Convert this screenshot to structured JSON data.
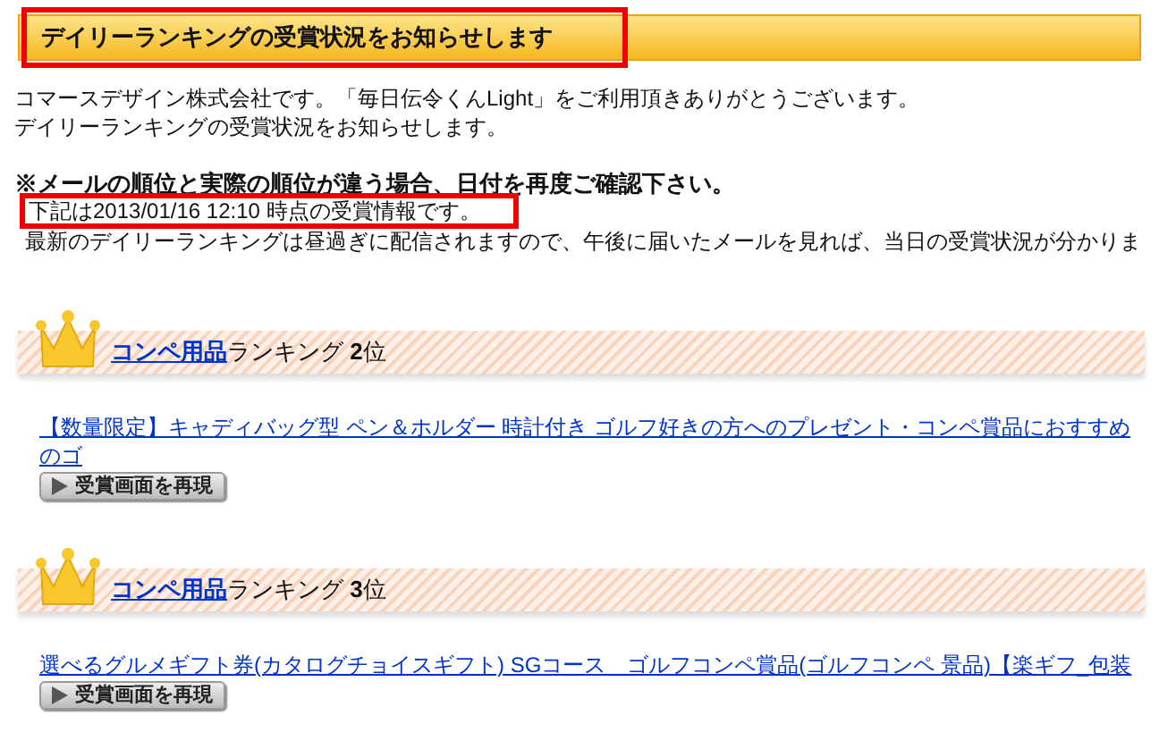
{
  "heading": "デイリーランキングの受賞状況をお知らせします",
  "intro": [
    "コマースデザイン株式会社です。「毎日伝令くんLight」をご利用頂きありがとうございます。",
    "デイリーランキングの受賞状況をお知らせします。"
  ],
  "notice": "※メールの順位と実際の順位が違う場合、日付を再度ご確認下さい。",
  "date_note": "下記は2013/01/16 12:10 時点の受賞情報です。",
  "note": "最新のデイリーランキングは昼過ぎに配信されますので、午後に届いたメールを見れば、当日の受賞状況が分かりま",
  "rankings": [
    {
      "category": "コンペ用品",
      "label": "ランキング **2**位",
      "item": "【数量限定】キャディバッグ型 ペン＆ホルダー 時計付き ゴルフ好きの方へのプレゼント・コンペ賞品におすすめのゴ",
      "button": "受賞画面を再現"
    },
    {
      "category": "コンペ用品",
      "label": "ランキング **3**位",
      "item": "選べるグルメギフト券(カタログチョイスギフト) SGコース　ゴルフコンペ賞品(ゴルフコンペ 景品)【楽ギフ_包装",
      "button": "受賞画面を再現"
    }
  ]
}
